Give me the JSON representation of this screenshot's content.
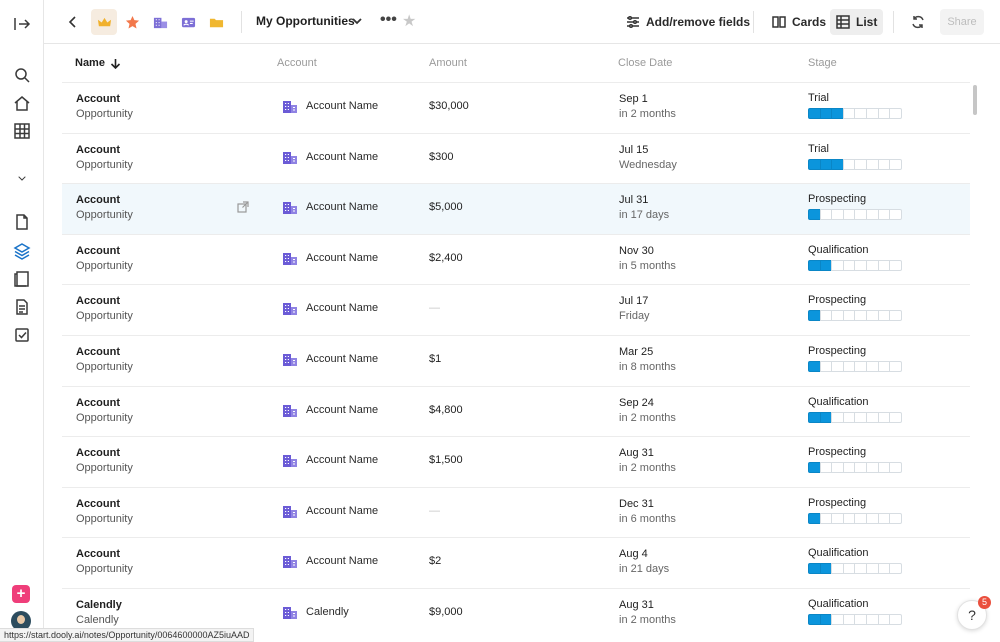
{
  "topbar": {
    "title": "My Opportunities",
    "add_remove_label": "Add/remove fields",
    "cards_label": "Cards",
    "list_label": "List",
    "share_label": "Share",
    "more_glyph": "•••",
    "star_glyph": "★",
    "type_icons": [
      "crown-icon",
      "starburst-icon",
      "buildings-icon",
      "contact-card-icon",
      "folder-icon"
    ]
  },
  "columns": {
    "name": "Name",
    "account": "Account",
    "amount": "Amount",
    "close_date": "Close Date",
    "stage": "Stage"
  },
  "rows": [
    {
      "name": "Account",
      "subname": "Opportunity",
      "account": "Account Name",
      "amount": "$30,000",
      "date": "Sep 1",
      "relative": "in 2 months",
      "stage": "Trial",
      "progress": 3
    },
    {
      "name": "Account",
      "subname": "Opportunity",
      "account": "Account Name",
      "amount": "$300",
      "date": "Jul 15",
      "relative": "Wednesday",
      "stage": "Trial",
      "progress": 3
    },
    {
      "name": "Account",
      "subname": "Opportunity",
      "account": "Account Name",
      "amount": "$5,000",
      "date": "Jul 31",
      "relative": "in 17 days",
      "stage": "Prospecting",
      "progress": 1
    },
    {
      "name": "Account",
      "subname": "Opportunity",
      "account": "Account Name",
      "amount": "$2,400",
      "date": "Nov 30",
      "relative": "in 5 months",
      "stage": "Qualification",
      "progress": 2
    },
    {
      "name": "Account",
      "subname": "Opportunity",
      "account": "Account Name",
      "amount": "—",
      "date": "Jul 17",
      "relative": "Friday",
      "stage": "Prospecting",
      "progress": 1
    },
    {
      "name": "Account",
      "subname": "Opportunity",
      "account": "Account Name",
      "amount": "$1",
      "date": "Mar 25",
      "relative": "in 8 months",
      "stage": "Prospecting",
      "progress": 1
    },
    {
      "name": "Account",
      "subname": "Opportunity",
      "account": "Account Name",
      "amount": "$4,800",
      "date": "Sep 24",
      "relative": "in 2 months",
      "stage": "Qualification",
      "progress": 2
    },
    {
      "name": "Account",
      "subname": "Opportunity",
      "account": "Account Name",
      "amount": "$1,500",
      "date": "Aug 31",
      "relative": "in 2 months",
      "stage": "Prospecting",
      "progress": 1
    },
    {
      "name": "Account",
      "subname": "Opportunity",
      "account": "Account Name",
      "amount": "—",
      "date": "Dec 31",
      "relative": "in 6 months",
      "stage": "Prospecting",
      "progress": 1
    },
    {
      "name": "Account",
      "subname": "Opportunity",
      "account": "Account Name",
      "amount": "$2",
      "date": "Aug 4",
      "relative": "in 21 days",
      "stage": "Qualification",
      "progress": 2
    },
    {
      "name": "Calendly",
      "subname": "Calendly",
      "account": "Calendly",
      "amount": "$9,000",
      "date": "Aug 31",
      "relative": "in 2 months",
      "stage": "Qualification",
      "progress": 2
    }
  ],
  "stage_segments": 8,
  "status_url": "https://start.dooly.ai/notes/Opportunity/0064600000AZ5iuAAD",
  "help": {
    "glyph": "?",
    "badge": "5"
  },
  "sidebar_plus": "+",
  "colors": {
    "accent": "#0b95dc",
    "badge": "#ea4f3d",
    "plus": "#ef3e7a",
    "account_icon": "#6b5bd6"
  }
}
